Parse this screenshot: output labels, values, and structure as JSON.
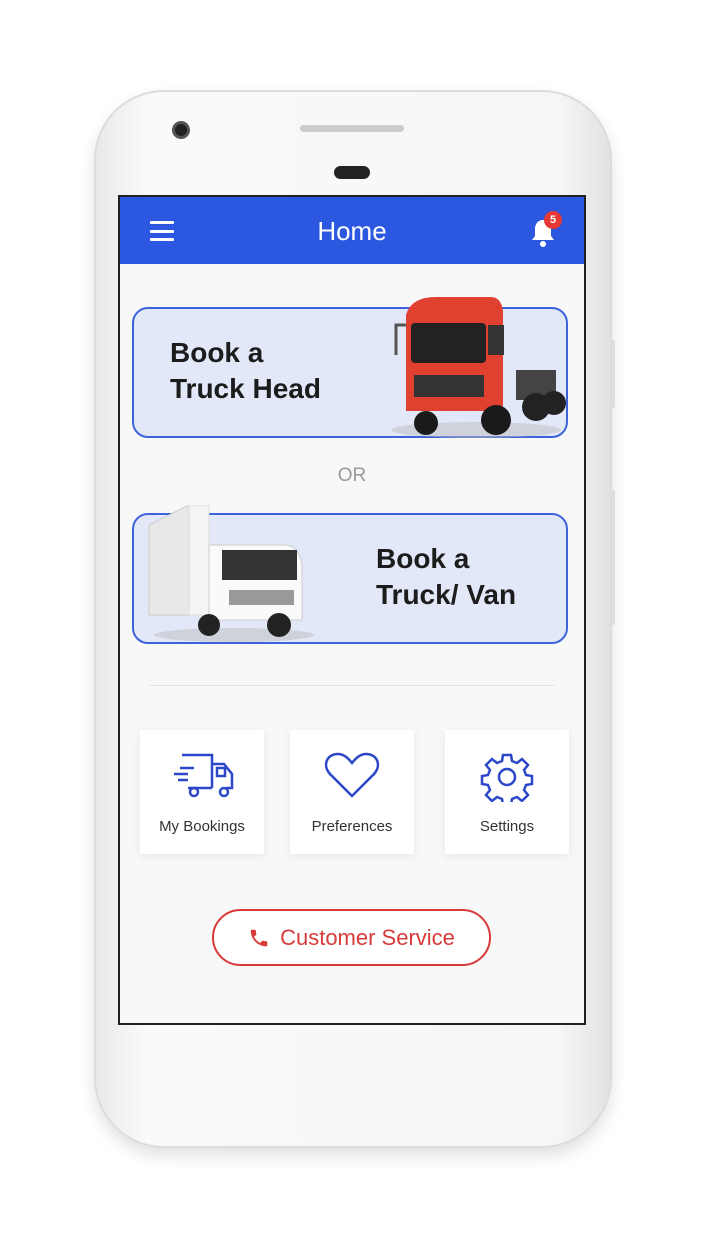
{
  "header": {
    "title": "Home",
    "notification_count": "5"
  },
  "cards": [
    {
      "line1": "Book a",
      "line2": "Truck Head"
    },
    {
      "line1": "Book a",
      "line2": "Truck/ Van"
    }
  ],
  "separator": "OR",
  "tiles": [
    {
      "label": "My Bookings",
      "icon": "delivery-truck-icon"
    },
    {
      "label": "Preferences",
      "icon": "heart-icon"
    },
    {
      "label": "Settings",
      "icon": "gear-icon"
    }
  ],
  "customer_service": {
    "label": "Customer Service",
    "icon": "phone-icon"
  },
  "colors": {
    "primary": "#2c57e0",
    "accent": "#d83a3a",
    "card_bg": "#e3e8f8"
  }
}
